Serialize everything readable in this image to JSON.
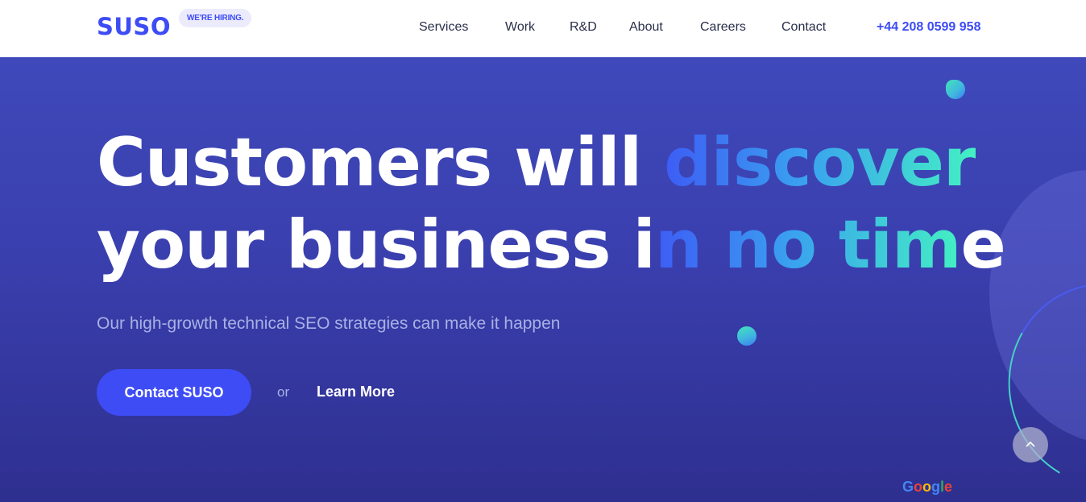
{
  "header": {
    "logo": "SUSO",
    "hiring_badge": "WE'RE HIRING.",
    "nav": [
      "Services",
      "Work",
      "R&D",
      "About",
      "Careers",
      "Contact"
    ],
    "phone": "+44 208 0599 958"
  },
  "hero": {
    "headline_line1_plain": "Customers will ",
    "headline_line1_highlight": "discover",
    "headline_line2_plain": "your business i",
    "headline_line2_highlight": "n no tim",
    "headline_line2_end": "e",
    "subheading": "Our high-growth technical SEO strategies can make it happen",
    "cta_primary": "Contact SUSO",
    "or_text": "or",
    "cta_secondary": "Learn More"
  },
  "badge": {
    "google_letters": [
      {
        "ch": "G",
        "color": "#4285f4"
      },
      {
        "ch": "o",
        "color": "#ea4335"
      },
      {
        "ch": "o",
        "color": "#fbbc05"
      },
      {
        "ch": "g",
        "color": "#4285f4"
      },
      {
        "ch": "l",
        "color": "#34a853"
      },
      {
        "ch": "e",
        "color": "#ea4335"
      }
    ]
  },
  "colors": {
    "accent": "#3d4cf5",
    "hero_bg": "#3f49ba",
    "gradient_start": "#3d5cf5",
    "gradient_end": "#43f0c3"
  },
  "icons": {
    "scroll_top": "chevron-up-icon"
  }
}
